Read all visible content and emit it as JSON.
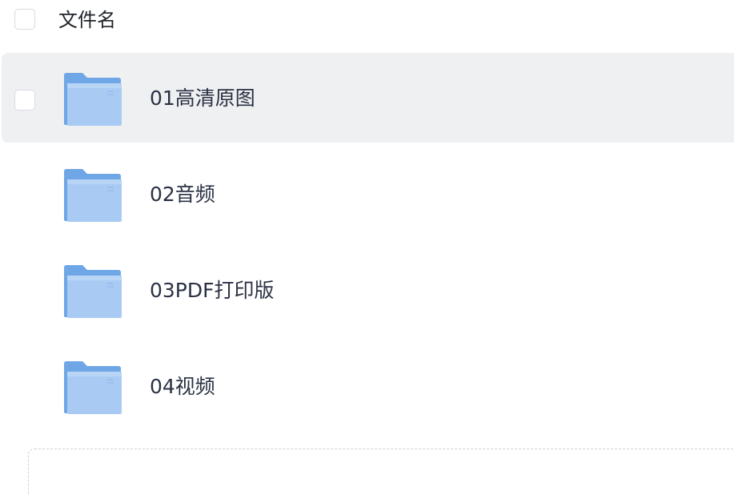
{
  "header": {
    "column_label": "文件名"
  },
  "files": [
    {
      "name": "01高清原图",
      "icon": "folder-icon",
      "hovered": true
    },
    {
      "name": "02音频",
      "icon": "folder-icon",
      "hovered": false
    },
    {
      "name": "03PDF打印版",
      "icon": "folder-icon",
      "hovered": false
    },
    {
      "name": "04视频",
      "icon": "folder-icon",
      "hovered": false
    }
  ],
  "colors": {
    "hover_bg": "#eff0f2",
    "folder_back": "#6fa6e6",
    "folder_front": "#a9cbf3",
    "text": "#2b3244"
  }
}
